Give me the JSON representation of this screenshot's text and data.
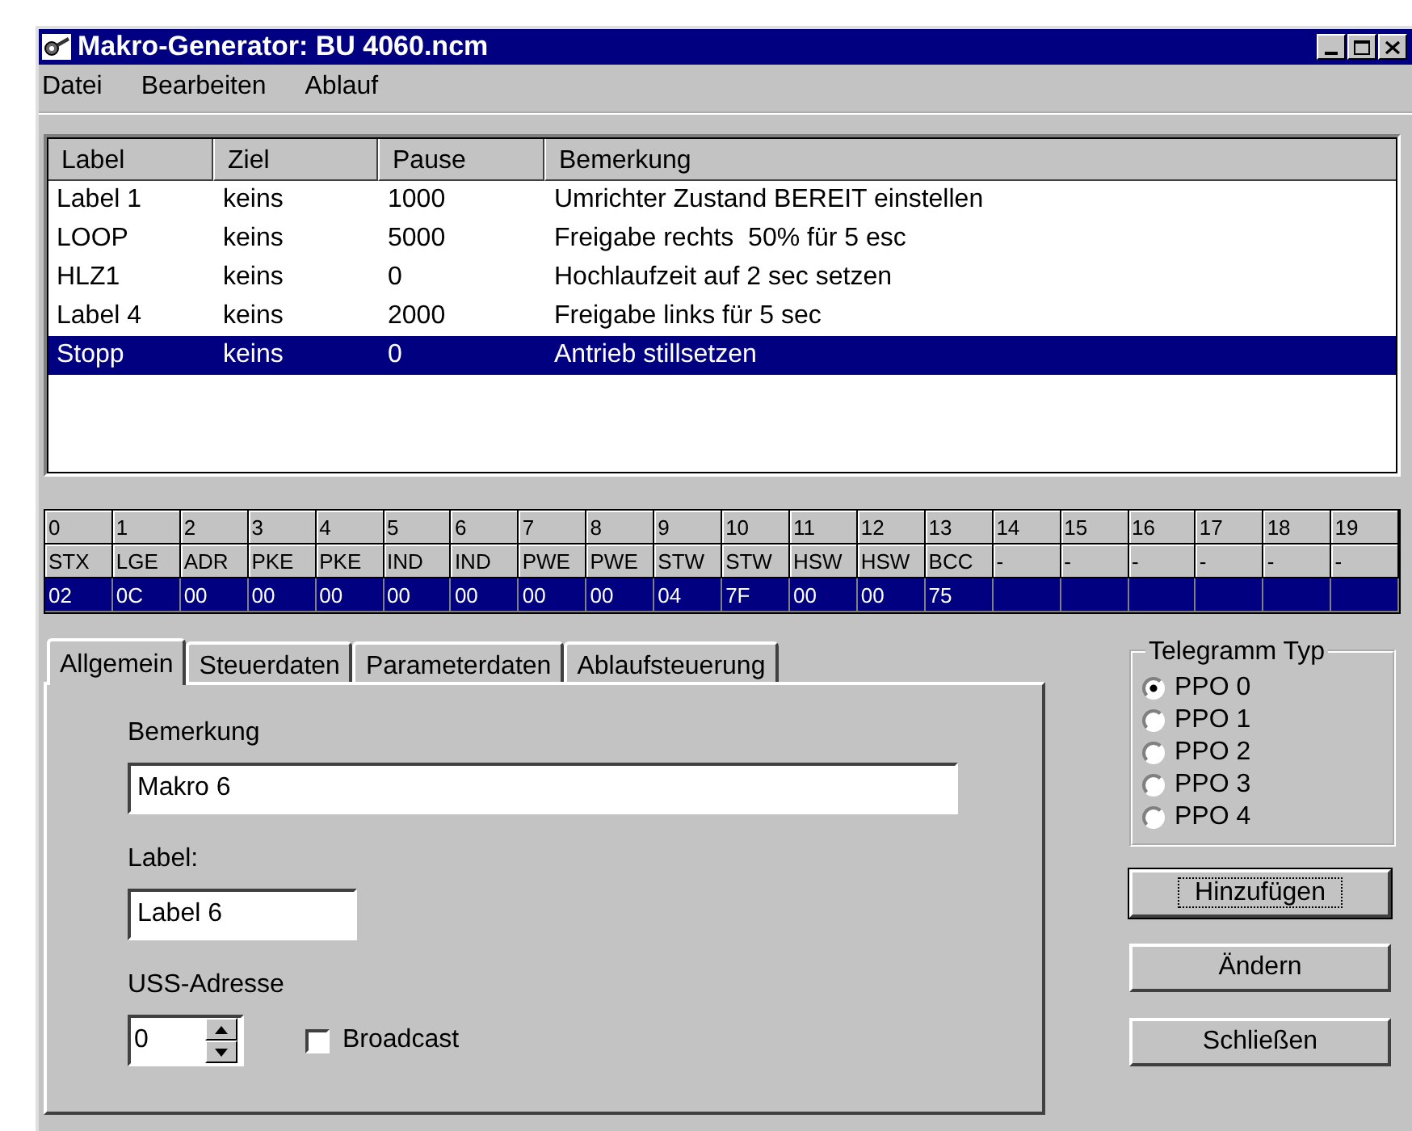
{
  "window": {
    "title": "Makro-Generator: BU 4060.ncm"
  },
  "menu": [
    "Datei",
    "Bearbeiten",
    "Ablauf"
  ],
  "macro_list": {
    "columns": [
      "Label",
      "Ziel",
      "Pause",
      "Bemerkung"
    ],
    "rows": [
      {
        "cells": [
          "Label 1",
          "keins",
          "1000",
          "Umrichter Zustand BEREIT einstellen"
        ],
        "selected": false
      },
      {
        "cells": [
          "LOOP",
          "keins",
          "5000",
          "Freigabe rechts  50% für 5 esc"
        ],
        "selected": false
      },
      {
        "cells": [
          "HLZ1",
          "keins",
          "0",
          "Hochlaufzeit auf 2 sec setzen"
        ],
        "selected": false
      },
      {
        "cells": [
          "Label 4",
          "keins",
          "2000",
          "Freigabe links für 5 sec"
        ],
        "selected": false
      },
      {
        "cells": [
          "Stopp",
          "keins",
          "0",
          "Antrieb stillsetzen"
        ],
        "selected": true
      }
    ]
  },
  "telegram": {
    "value_row_selected": true,
    "bytes": [
      {
        "index": "0",
        "name": "STX",
        "value": "02"
      },
      {
        "index": "1",
        "name": "LGE",
        "value": "0C"
      },
      {
        "index": "2",
        "name": "ADR",
        "value": "00"
      },
      {
        "index": "3",
        "name": "PKE",
        "value": "00"
      },
      {
        "index": "4",
        "name": "PKE",
        "value": "00"
      },
      {
        "index": "5",
        "name": "IND",
        "value": "00"
      },
      {
        "index": "6",
        "name": "IND",
        "value": "00"
      },
      {
        "index": "7",
        "name": "PWE",
        "value": "00"
      },
      {
        "index": "8",
        "name": "PWE",
        "value": "00"
      },
      {
        "index": "9",
        "name": "STW",
        "value": "04"
      },
      {
        "index": "10",
        "name": "STW",
        "value": "7F"
      },
      {
        "index": "11",
        "name": "HSW",
        "value": "00"
      },
      {
        "index": "12",
        "name": "HSW",
        "value": "00"
      },
      {
        "index": "13",
        "name": "BCC",
        "value": "75"
      },
      {
        "index": "14",
        "name": "-"
      },
      {
        "index": "15",
        "name": "-"
      },
      {
        "index": "16",
        "name": "-"
      },
      {
        "index": "17",
        "name": "-"
      },
      {
        "index": "18",
        "name": "-"
      },
      {
        "index": "19",
        "name": "-"
      }
    ]
  },
  "tabs": [
    {
      "label": "Allgemein",
      "selected": true
    },
    {
      "label": "Steuerdaten",
      "selected": false
    },
    {
      "label": "Parameterdaten",
      "selected": false
    },
    {
      "label": "Ablaufsteuerung",
      "selected": false
    }
  ],
  "general": {
    "remark_label": "Bemerkung",
    "remark_value": "Makro 6",
    "label_label": "Label:",
    "label_value": "Label 6",
    "address_label": "USS-Adresse",
    "address_value": "0",
    "broadcast": {
      "label": "Broadcast",
      "checked": false
    }
  },
  "telegram_type": {
    "title": "Telegramm Typ",
    "options": [
      {
        "label": "PPO 0",
        "selected": true
      },
      {
        "label": "PPO 1",
        "selected": false
      },
      {
        "label": "PPO 2",
        "selected": false
      },
      {
        "label": "PPO 3",
        "selected": false
      },
      {
        "label": "PPO 4",
        "selected": false
      }
    ]
  },
  "buttons": [
    {
      "label": "Hinzufügen",
      "default": true
    },
    {
      "label": "Ändern",
      "default": false
    },
    {
      "label": "Schließen",
      "default": false
    }
  ]
}
